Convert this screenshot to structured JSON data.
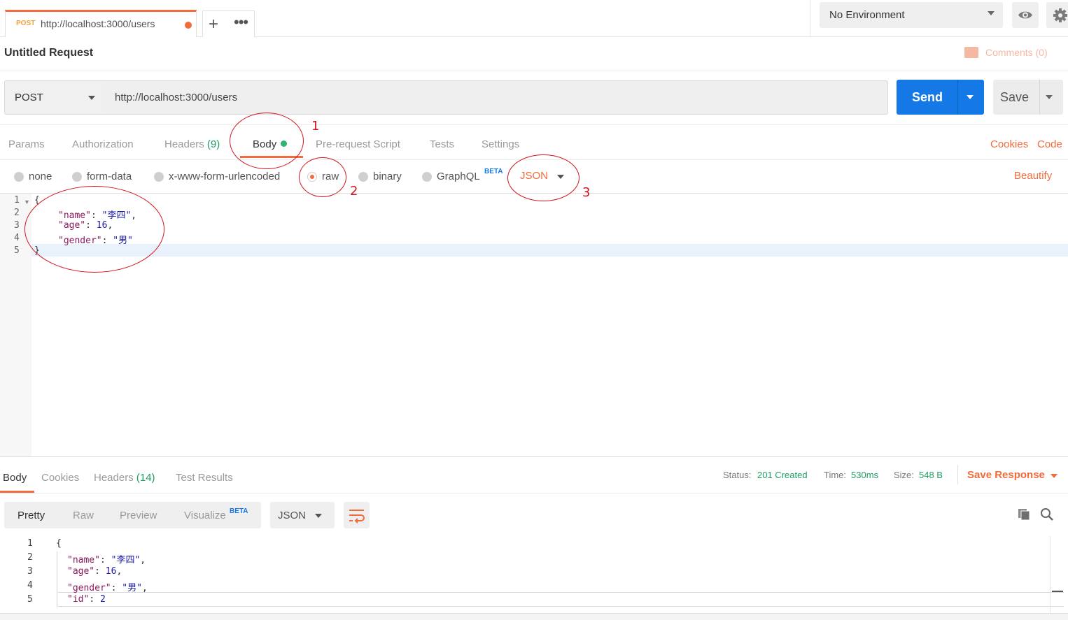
{
  "tab": {
    "method": "POST",
    "url": "http://localhost:3000/users"
  },
  "env": {
    "selected": "No Environment"
  },
  "title": "Untitled Request",
  "comments": "Comments (0)",
  "request": {
    "method": "POST",
    "url": "http://localhost:3000/users",
    "send": "Send",
    "save": "Save"
  },
  "reqtabs": {
    "params": "Params",
    "authorization": "Authorization",
    "headers": "Headers",
    "headers_count": "(9)",
    "body": "Body",
    "prerequest": "Pre-request Script",
    "tests": "Tests",
    "settings": "Settings",
    "cookies": "Cookies",
    "code": "Code"
  },
  "bodytypes": {
    "none": "none",
    "formdata": "form-data",
    "urlencoded": "x-www-form-urlencoded",
    "raw": "raw",
    "binary": "binary",
    "graphql": "GraphQL",
    "beta": "BETA",
    "lang": "JSON",
    "beautify": "Beautify"
  },
  "editor": {
    "line_numbers": [
      "1",
      "2",
      "3",
      "4",
      "5"
    ],
    "lines": [
      {
        "open": "{"
      },
      {
        "key": "\"name\"",
        "val": "\"李四\"",
        "tail": ","
      },
      {
        "key": "\"age\"",
        "val": "16",
        "tail": ","
      },
      {
        "key": "\"gender\"",
        "val": "\"男\"",
        "tail": ""
      },
      {
        "close": "}"
      }
    ]
  },
  "response": {
    "tabs": {
      "body": "Body",
      "cookies": "Cookies",
      "headers": "Headers",
      "headers_count": "(14)",
      "tests": "Test Results"
    },
    "status_label": "Status:",
    "status": "201 Created",
    "time_label": "Time:",
    "time": "530ms",
    "size_label": "Size:",
    "size": "548 B",
    "save_response": "Save Response",
    "views": {
      "pretty": "Pretty",
      "raw": "Raw",
      "preview": "Preview",
      "visualize": "Visualize",
      "beta": "BETA"
    },
    "format": "JSON",
    "line_numbers": [
      "1",
      "2",
      "3",
      "4",
      "5"
    ],
    "lines": [
      {
        "open": "{"
      },
      {
        "key": "\"name\"",
        "val": "\"李四\"",
        "tail": ","
      },
      {
        "key": "\"age\"",
        "val": "16",
        "tail": ","
      },
      {
        "key": "\"gender\"",
        "val": "\"男\"",
        "tail": ","
      },
      {
        "key": "\"id\"",
        "val": "2",
        "tail": ""
      }
    ]
  },
  "annotations": [
    "1",
    "2",
    "3"
  ],
  "colors": {
    "accent": "#f26b3a",
    "send_blue": "#1478e6",
    "success_green": "#1e9e62",
    "annotation_red": "#d2141f"
  }
}
